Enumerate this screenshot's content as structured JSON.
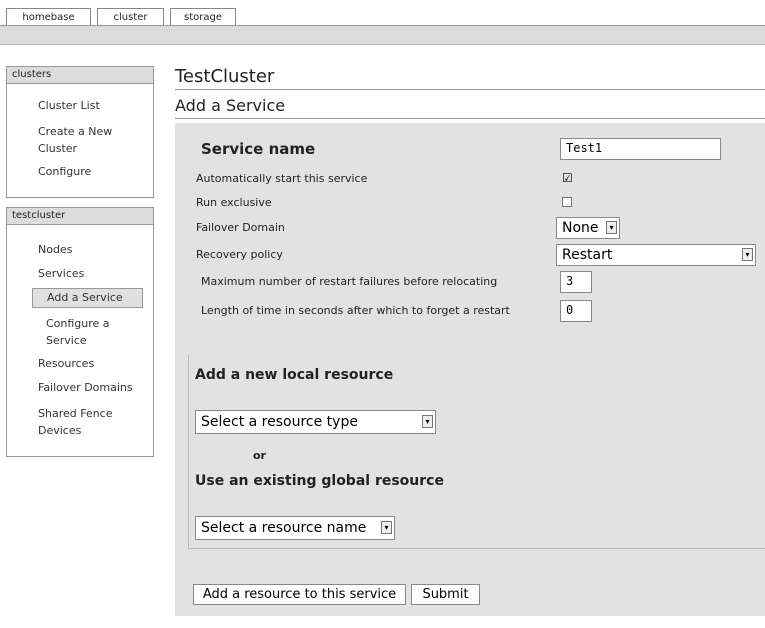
{
  "tabs": [
    "homebase",
    "cluster",
    "storage"
  ],
  "nav": {
    "clusters": {
      "header": "clusters",
      "items": [
        "Cluster List",
        "Create a New Cluster",
        "Configure"
      ]
    },
    "testcluster": {
      "header": "testcluster",
      "items": [
        "Nodes",
        "Services",
        "Add a Service",
        "Configure a Service",
        "Resources",
        "Failover Domains",
        "Shared Fence Devices"
      ]
    }
  },
  "main": {
    "title": "TestCluster",
    "subtitle": "Add a Service"
  },
  "form": {
    "service_name_label": "Service name",
    "service_name_value": "Test1",
    "autostart_label": "Automatically start this service",
    "autostart_checked": "☑",
    "run_exclusive_label": "Run exclusive",
    "failover_domain_label": "Failover Domain",
    "failover_domain_value": "None",
    "recovery_policy_label": "Recovery policy",
    "recovery_policy_value": "Restart",
    "max_restart_label": "Maximum number of restart failures before relocating",
    "max_restart_value": "3",
    "forget_restart_label": "Length of time in seconds after which to forget a restart",
    "forget_restart_value": "0"
  },
  "resources": {
    "add_local_heading": "Add a new local resource",
    "resource_type_placeholder": "Select a resource type",
    "or_label": "or",
    "use_global_heading": "Use an existing global resource",
    "resource_name_placeholder": "Select a resource name"
  },
  "buttons": {
    "add_resource": "Add a resource to this service",
    "submit": "Submit"
  },
  "icons": {
    "dropdown": "▾"
  }
}
